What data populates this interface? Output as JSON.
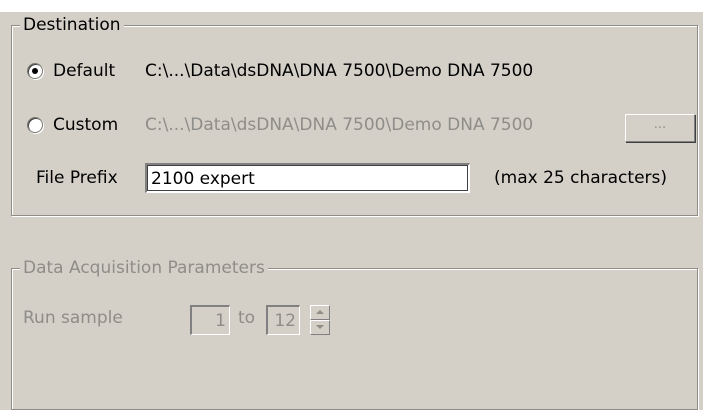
{
  "destination": {
    "title": "Destination",
    "default_label": "Default",
    "default_path": "C:\\...\\Data\\dsDNA\\DNA 7500\\Demo DNA 7500",
    "default_selected": true,
    "custom_label": "Custom",
    "custom_path": "C:\\...\\Data\\dsDNA\\DNA 7500\\Demo DNA 7500",
    "browse_label": "...",
    "file_prefix_label": "File Prefix",
    "file_prefix_value": "2100 expert",
    "max_note": "(max 25 characters)"
  },
  "acquisition": {
    "title": "Data Acquisition Parameters",
    "run_sample_label": "Run sample",
    "from_value": "1",
    "to_label": "to",
    "to_value": "12"
  }
}
